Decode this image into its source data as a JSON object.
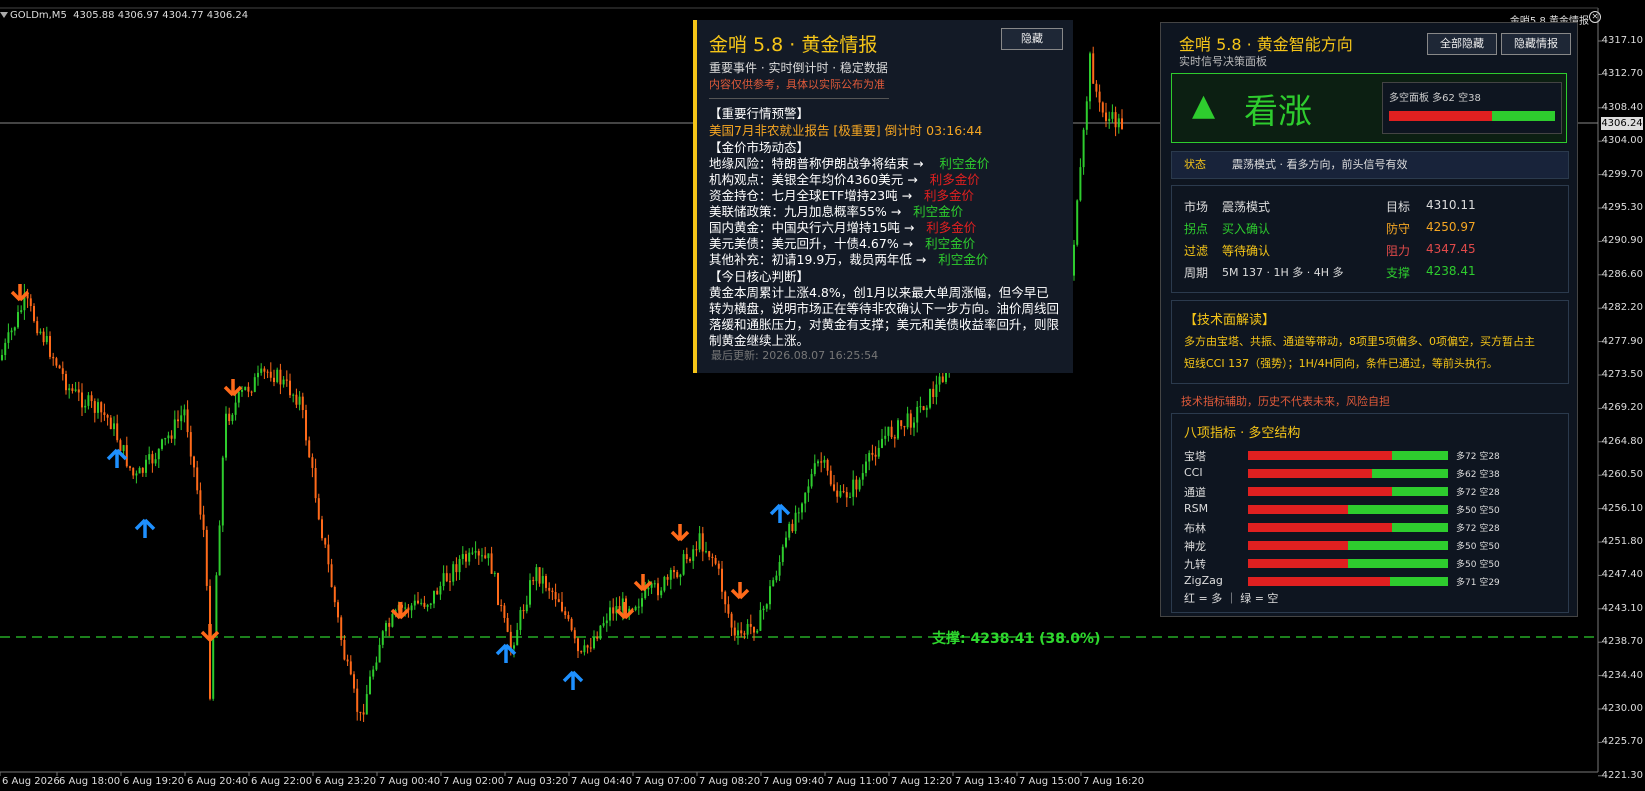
{
  "symbol": {
    "name": "GOLDm,M5",
    "ohlc": "4305.88 4306.97 4304.77 4306.24"
  },
  "top_right_label": "金哨5.8 黄金情报",
  "close_glyph": "✕",
  "price_axis": {
    "labels": [
      "4317.10",
      "4312.70",
      "4308.40",
      "4304.00",
      "4299.70",
      "4295.30",
      "4290.90",
      "4286.60",
      "4282.20",
      "4277.90",
      "4273.50",
      "4269.20",
      "4264.80",
      "4260.50",
      "4256.10",
      "4251.80",
      "4247.40",
      "4243.10",
      "4238.70",
      "4234.40",
      "4230.00",
      "4225.70",
      "4221.30"
    ],
    "current_price": "4306.24"
  },
  "time_axis": [
    "6 Aug 2026",
    "6 Aug 18:00",
    "6 Aug 19:20",
    "6 Aug 20:40",
    "6 Aug 22:00",
    "6 Aug 23:20",
    "7 Aug 00:40",
    "7 Aug 02:00",
    "7 Aug 03:20",
    "7 Aug 04:40",
    "7 Aug 07:00",
    "7 Aug 08:20",
    "7 Aug 09:40",
    "7 Aug 11:00",
    "7 Aug 12:20",
    "7 Aug 13:40",
    "7 Aug 15:00",
    "7 Aug 16:20"
  ],
  "support_line_label": "支撑: 4238.41 (38.0%)",
  "colors": {
    "bull_candle": "#2ecc2e",
    "bear_candle": "#ff6a1a",
    "buy_arrow": "#1e90ff",
    "sell_arrow": "#ff6a1a",
    "gold": "#f5c518"
  },
  "info_panel": {
    "title": "金哨 5.8 · 黄金情报",
    "subtitle": "重要事件 · 实时倒计时 · 稳定数据",
    "warning": "内容仅供参考，具体以实际公布为准",
    "hide_button": "隐藏",
    "alert_header": "【重要行情预警】",
    "alert_text": "美国7月非农就业报告 [极重要] 倒计时 03:16:44",
    "dynamics_header": "【金价市场动态】",
    "rows": [
      {
        "label": "地缘风险：特朗普称伊朗战争将结束 →",
        "tag": "利空金价",
        "kind": "bear"
      },
      {
        "label": "机构观点：美银全年均价4360美元 →",
        "tag": "利多金价",
        "kind": "bull"
      },
      {
        "label": "资金持仓：七月全球ETF增持23吨 →",
        "tag": "利多金价",
        "kind": "bull"
      },
      {
        "label": "美联储政策：九月加息概率55% →",
        "tag": "利空金价",
        "kind": "bear"
      },
      {
        "label": "国内黄金：中国央行六月增持15吨 →",
        "tag": "利多金价",
        "kind": "bull"
      },
      {
        "label": "美元美债：美元回升，十债4.67% →",
        "tag": "利空金价",
        "kind": "bear"
      },
      {
        "label": "其他补充：初请19.9万，裁员两年低 →",
        "tag": "利空金价",
        "kind": "bear"
      }
    ],
    "core_header": "【今日核心判断】",
    "core_text": "黄金本周累计上涨4.8%，创1月以来最大单周涨幅，但今早已转为横盘，说明市场正在等待非农确认下一步方向。油价周线回落缓和通胀压力，对黄金有支撑；美元和美债收益率回升，则限制黄金继续上涨。",
    "updated": "最后更新: 2026.08.07 16:25:54"
  },
  "right_panel": {
    "title": "金哨 5.8 · 黄金智能方向",
    "subtitle": "实时信号决策面板",
    "btn_hide_all": "全部隐藏",
    "btn_hide_info": "隐藏情报",
    "direction_arrow": "▲",
    "direction_text": "看涨",
    "pressure_label": "多空面板 多62 空38",
    "pressure_bull": 62,
    "status_key": "状态",
    "status_value": "震荡模式 · 看多方向，前头信号有效",
    "grid": {
      "market_k": "市场",
      "market_v": "震荡模式",
      "target_k": "目标",
      "target_v": "4310.11",
      "turn_k": "拐点",
      "turn_v": "买入确认",
      "defend_k": "防守",
      "defend_v": "4250.97",
      "filter_k": "过滤",
      "filter_v": "等待确认",
      "resist_k": "阻力",
      "resist_v": "4347.45",
      "period_k": "周期",
      "period_v": "5M 137 · 1H 多 · 4H 多",
      "support_k": "支撑",
      "support_v": "4238.41"
    },
    "tech_header": "【技术面解读】",
    "tech_l1": "多方由宝塔、共振、通道等带动，8项里5项偏多、0项偏空，买方暂占主",
    "tech_l2": "短线CCI 137（强势）；1H/4H同向，条件已通过，等前头执行。",
    "disclaimer": "技术指标辅助，历史不代表未来，风险自担",
    "ind_header": "八项指标 · 多空结构",
    "indicators": [
      {
        "name": "宝塔",
        "bull": 72,
        "label": "多72 空28"
      },
      {
        "name": "CCI",
        "bull": 62,
        "label": "多62 空38"
      },
      {
        "name": "通道",
        "bull": 72,
        "label": "多72 空28"
      },
      {
        "name": "RSM",
        "bull": 50,
        "label": "多50 空50"
      },
      {
        "name": "布林",
        "bull": 72,
        "label": "多72 空28"
      },
      {
        "name": "神龙",
        "bull": 50,
        "label": "多50 空50"
      },
      {
        "name": "九转",
        "bull": 50,
        "label": "多50 空50"
      },
      {
        "name": "ZigZag",
        "bull": 71,
        "label": "多71 空29"
      }
    ],
    "legend": "红 = 多 ｜ 绿 = 空"
  }
}
